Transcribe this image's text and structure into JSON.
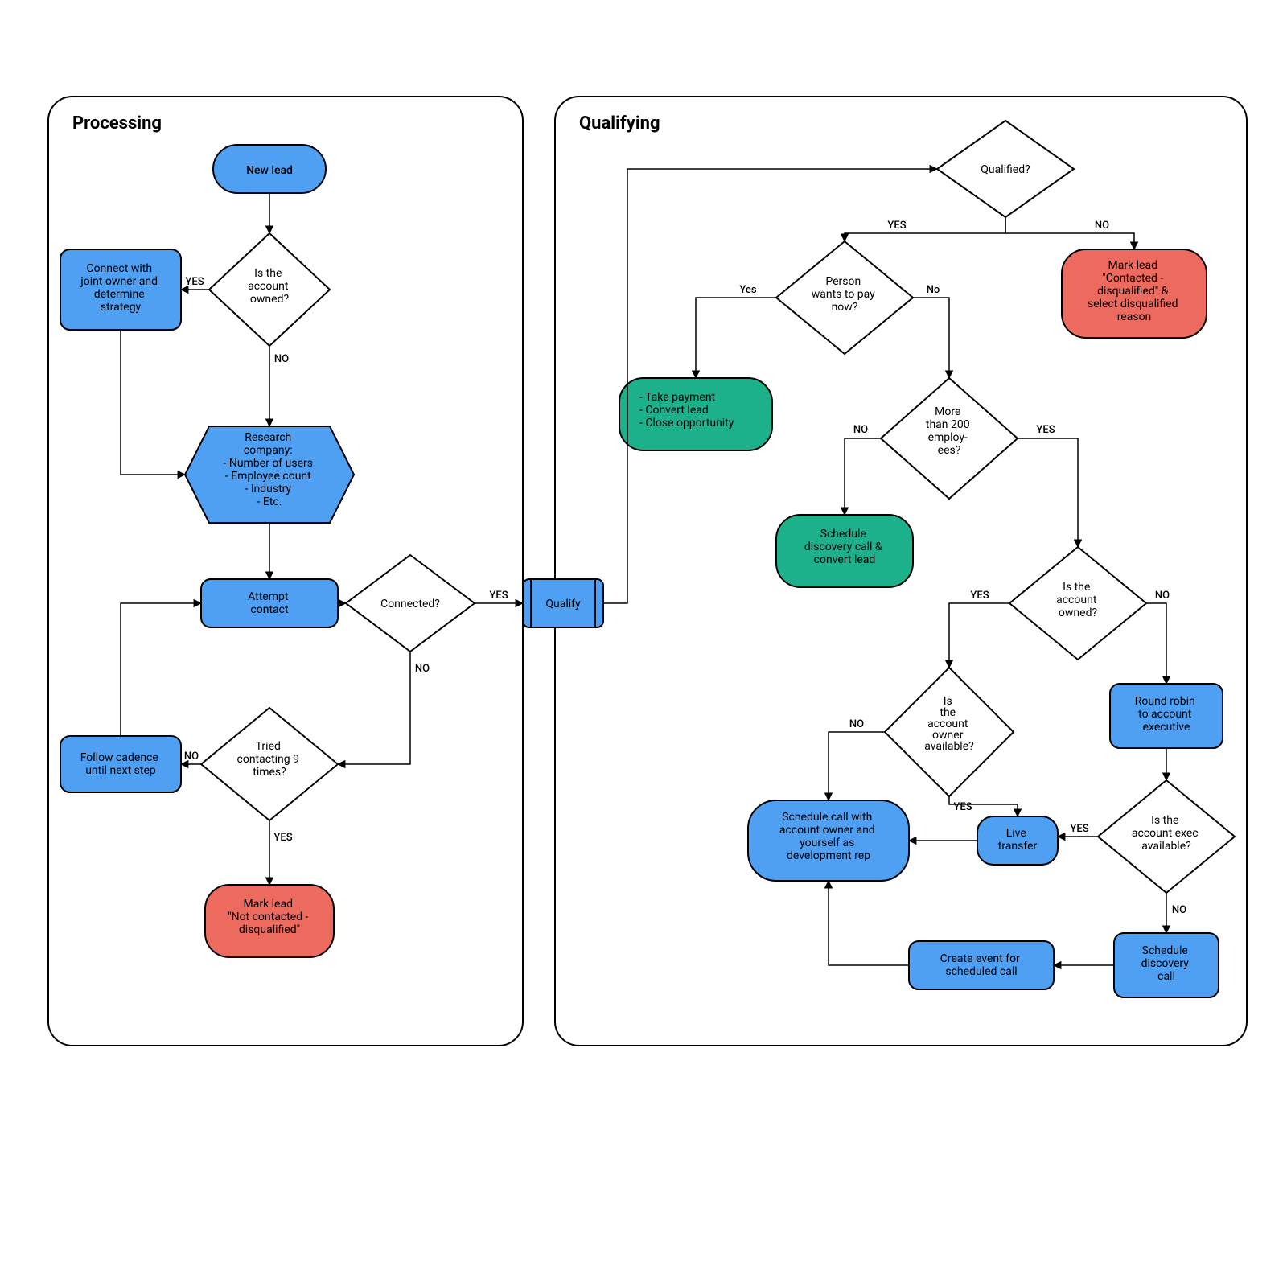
{
  "groups": {
    "processing": "Processing",
    "qualifying": "Qualifying"
  },
  "nodes": {
    "newLead": "New lead",
    "isOwned1": "Is the\naccount\nowned?",
    "connectJoint": "Connect with\njoint owner and\ndetermine\nstrategy",
    "research": "Research\ncompany:\n- Number of users\n- Employee count\n- Industry\n- Etc.",
    "attempt": "Attempt\ncontact",
    "connected": "Connected?",
    "tried9": "Tried\ncontacting 9\ntimes?",
    "followCadence": "Follow cadence\nuntil next step",
    "markNotContacted": "Mark lead\n\"Not contacted -\ndisqualified\"",
    "qualify": "Qualify",
    "qualified": "Qualified?",
    "markDisq": "Mark lead\n\"Contacted -\ndisqualified\" &\nselect disqualified\nreason",
    "wantsPay": "Person\nwants to pay\nnow?",
    "takePayment": "- Take payment\n- Convert lead\n- Close opportunity",
    "more200": "More\nthan 200\nemploy-\nees?",
    "scheduleDiscConvert": "Schedule\ndiscovery call &\nconvert lead",
    "isOwned2": "Is the\naccount\nowned?",
    "ownerAvail": "Is\nthe\naccount\nowner\navailable?",
    "roundRobin": "Round robin\nto account\nexecutive",
    "execAvail": "Is the\naccount exec\navailable?",
    "liveTransfer": "Live\ntransfer",
    "scheduleCallDev": "Schedule call with\naccount owner and\nyourself as\ndevelopment rep",
    "scheduleDisc": "Schedule\ndiscovery\ncall",
    "createEvent": "Create event for\nscheduled call"
  },
  "labels": {
    "yes": "YES",
    "no": "NO",
    "yesLower": "Yes",
    "noLower": "No"
  },
  "colors": {
    "blue": "#4f9ff2",
    "green": "#1cb08b",
    "red": "#ed6a5e"
  }
}
